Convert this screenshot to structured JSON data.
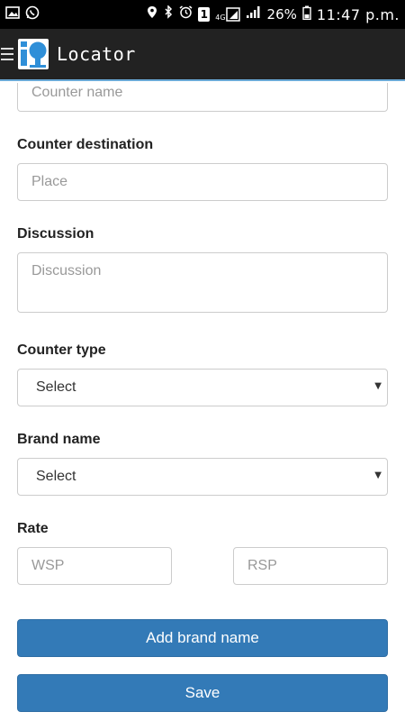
{
  "status_bar": {
    "icons_left": [
      "gallery-icon",
      "whatsapp-icon"
    ],
    "icons_right": [
      "location-icon",
      "bluetooth-icon",
      "alarm-icon",
      "sim-icon",
      "network-icon",
      "signal-icon"
    ],
    "sim_number": "1",
    "network_type": "4G",
    "battery_percent": "26%",
    "time": "11:47 p.m."
  },
  "app_bar": {
    "title": "Locator",
    "logo": "locator-logo",
    "logo_color": "#2f8fd8"
  },
  "form": {
    "counter_name": {
      "placeholder": "Counter name",
      "value": ""
    },
    "counter_destination": {
      "label": "Counter destination",
      "placeholder": "Place",
      "value": ""
    },
    "discussion": {
      "label": "Discussion",
      "placeholder": "Discussion",
      "value": ""
    },
    "counter_type": {
      "label": "Counter type",
      "selected": "Select"
    },
    "brand_name": {
      "label": "Brand name",
      "selected": "Select"
    },
    "rate": {
      "label": "Rate",
      "wsp": {
        "placeholder": "WSP",
        "value": ""
      },
      "rsp": {
        "placeholder": "RSP",
        "value": ""
      }
    },
    "add_brand_button": "Add brand name",
    "save_button": "Save"
  },
  "colors": {
    "primary_button": "#337ab7",
    "app_bar": "#222222",
    "status_bar": "#000000"
  }
}
